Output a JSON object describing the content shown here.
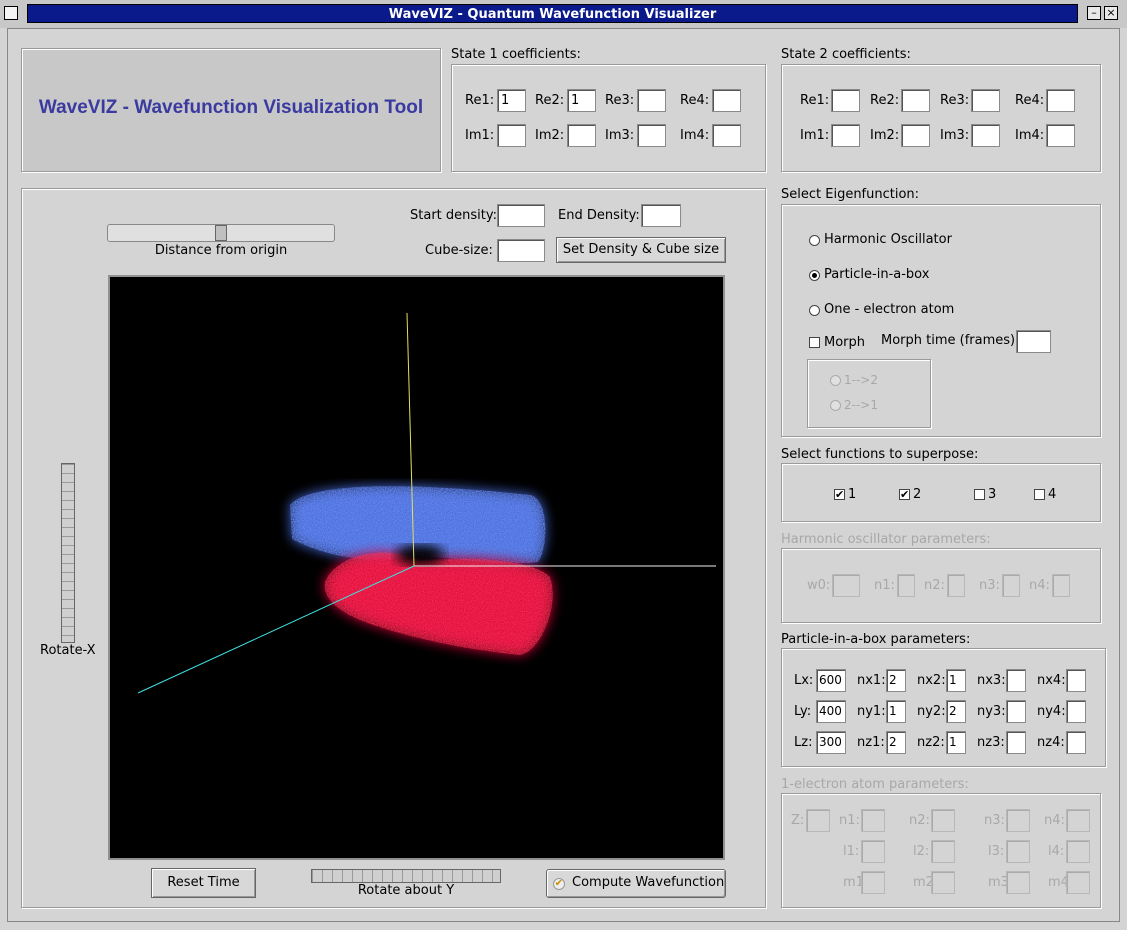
{
  "window": {
    "title": "WaveVIZ - Quantum Wavefunction Visualizer"
  },
  "banner": {
    "title": "WaveVIZ - Wavefunction Visualization Tool"
  },
  "state1": {
    "label": "State 1 coefficients:",
    "re": [
      {
        "label": "Re1:",
        "value": "1"
      },
      {
        "label": "Re2:",
        "value": "1"
      },
      {
        "label": "Re3:",
        "value": ""
      },
      {
        "label": "Re4:",
        "value": ""
      }
    ],
    "im": [
      {
        "label": "Im1:",
        "value": ""
      },
      {
        "label": "Im2:",
        "value": ""
      },
      {
        "label": "Im3:",
        "value": ""
      },
      {
        "label": "Im4:",
        "value": ""
      }
    ]
  },
  "state2": {
    "label": "State 2 coefficients:",
    "re": [
      {
        "label": "Re1:",
        "value": ""
      },
      {
        "label": "Re2:",
        "value": ""
      },
      {
        "label": "Re3:",
        "value": ""
      },
      {
        "label": "Re4:",
        "value": ""
      }
    ],
    "im": [
      {
        "label": "Im1:",
        "value": ""
      },
      {
        "label": "Im2:",
        "value": ""
      },
      {
        "label": "Im3:",
        "value": ""
      },
      {
        "label": "Im4:",
        "value": ""
      }
    ]
  },
  "view": {
    "distance_label": "Distance from origin",
    "distance_value": 0.5,
    "start_density_label": "Start density:",
    "start_density_value": "",
    "end_density_label": "End Density:",
    "end_density_value": "",
    "cube_size_label": "Cube-size:",
    "cube_size_value": "",
    "set_button": "Set Density & Cube size",
    "rotate_x_label": "Rotate-X",
    "rotate_y_label": "Rotate about Y",
    "reset_button": "Reset Time",
    "compute_label": "Compute Wavefunction",
    "compute_checked": true,
    "axis_colors": {
      "y": "#e0e060",
      "x": "#f0f0f0",
      "z": "#40e0e0"
    },
    "density_colors": {
      "upper": "#4a6ee0",
      "lower": "#e0103c"
    }
  },
  "eigen": {
    "label": "Select Eigenfunction:",
    "options": [
      {
        "label": "Harmonic Oscillator",
        "selected": false
      },
      {
        "label": "Particle-in-a-box",
        "selected": true
      },
      {
        "label": "One - electron atom",
        "selected": false
      }
    ],
    "morph_label": "Morph",
    "morph_checked": false,
    "morph_time_label": "Morph time (frames):",
    "morph_time_value": "",
    "direction_options": [
      "1-->2",
      "2-->1"
    ]
  },
  "superpose": {
    "label": "Select functions to superpose:",
    "items": [
      {
        "label": "1",
        "checked": true
      },
      {
        "label": "2",
        "checked": true
      },
      {
        "label": "3",
        "checked": false
      },
      {
        "label": "4",
        "checked": false
      }
    ]
  },
  "harmonic": {
    "label": "Harmonic oscillator parameters:",
    "fields": [
      {
        "label": "w0:",
        "value": ""
      },
      {
        "label": "n1:",
        "value": ""
      },
      {
        "label": "n2:",
        "value": ""
      },
      {
        "label": "n3:",
        "value": ""
      },
      {
        "label": "n4:",
        "value": ""
      }
    ]
  },
  "pib": {
    "label": "Particle-in-a-box parameters:",
    "rows": [
      [
        {
          "label": "Lx:",
          "value": "600"
        },
        {
          "label": "nx1:",
          "value": "2"
        },
        {
          "label": "nx2:",
          "value": "1"
        },
        {
          "label": "nx3:",
          "value": ""
        },
        {
          "label": "nx4:",
          "value": ""
        }
      ],
      [
        {
          "label": "Ly:",
          "value": "400"
        },
        {
          "label": "ny1:",
          "value": "1"
        },
        {
          "label": "ny2:",
          "value": "2"
        },
        {
          "label": "ny3:",
          "value": ""
        },
        {
          "label": "ny4:",
          "value": ""
        }
      ],
      [
        {
          "label": "Lz:",
          "value": "300"
        },
        {
          "label": "nz1:",
          "value": "2"
        },
        {
          "label": "nz2:",
          "value": "1"
        },
        {
          "label": "nz3:",
          "value": ""
        },
        {
          "label": "nz4:",
          "value": ""
        }
      ]
    ]
  },
  "atom": {
    "label": "1-electron atom parameters:",
    "rows": [
      [
        {
          "label": "Z:",
          "value": ""
        },
        {
          "label": "n1:",
          "value": ""
        },
        {
          "label": "n2:",
          "value": ""
        },
        {
          "label": "n3:",
          "value": ""
        },
        {
          "label": "n4:",
          "value": ""
        }
      ],
      [
        {
          "label": "",
          "value": null
        },
        {
          "label": "l1:",
          "value": ""
        },
        {
          "label": "l2:",
          "value": ""
        },
        {
          "label": "l3:",
          "value": ""
        },
        {
          "label": "l4:",
          "value": ""
        }
      ],
      [
        {
          "label": "",
          "value": null
        },
        {
          "label": "m1:",
          "value": ""
        },
        {
          "label": "m2:",
          "value": ""
        },
        {
          "label": "m3:",
          "value": ""
        },
        {
          "label": "m4:",
          "value": ""
        }
      ]
    ]
  }
}
